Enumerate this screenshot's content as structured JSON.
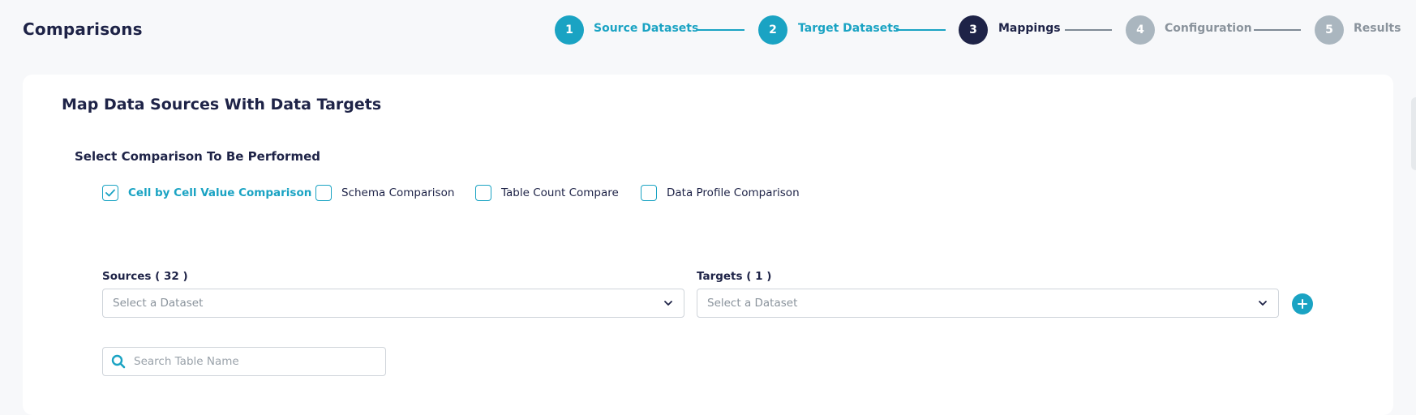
{
  "header": {
    "title": "Comparisons"
  },
  "stepper": {
    "steps": [
      {
        "number": "1",
        "label": "Source Datasets",
        "state": "done"
      },
      {
        "number": "2",
        "label": "Target Datasets",
        "state": "done"
      },
      {
        "number": "3",
        "label": "Mappings",
        "state": "current"
      },
      {
        "number": "4",
        "label": "Configuration",
        "state": "pending"
      },
      {
        "number": "5",
        "label": "Results",
        "state": "pending"
      }
    ]
  },
  "main": {
    "title": "Map Data Sources With Data Targets",
    "comparison_section_label": "Select Comparison To Be Performed",
    "comparison_options": [
      {
        "label": "Cell by Cell Value Comparison",
        "checked": true
      },
      {
        "label": "Schema Comparison",
        "checked": false
      },
      {
        "label": "Table Count Compare",
        "checked": false
      },
      {
        "label": "Data Profile Comparison",
        "checked": false
      }
    ],
    "sources": {
      "label": "Sources ( 32 )",
      "placeholder": "Select a Dataset"
    },
    "targets": {
      "label": "Targets ( 1 )",
      "placeholder": "Select a Dataset"
    },
    "search": {
      "placeholder": "Search Table Name",
      "value": ""
    }
  },
  "colors": {
    "accent": "#1aa3c3",
    "navy": "#1e2347",
    "pending": "#aab6bf",
    "background": "#f7f8fa"
  },
  "icons": {
    "check": "check-icon",
    "chevron": "chevron-down-icon",
    "add": "plus-icon",
    "search": "search-icon"
  }
}
